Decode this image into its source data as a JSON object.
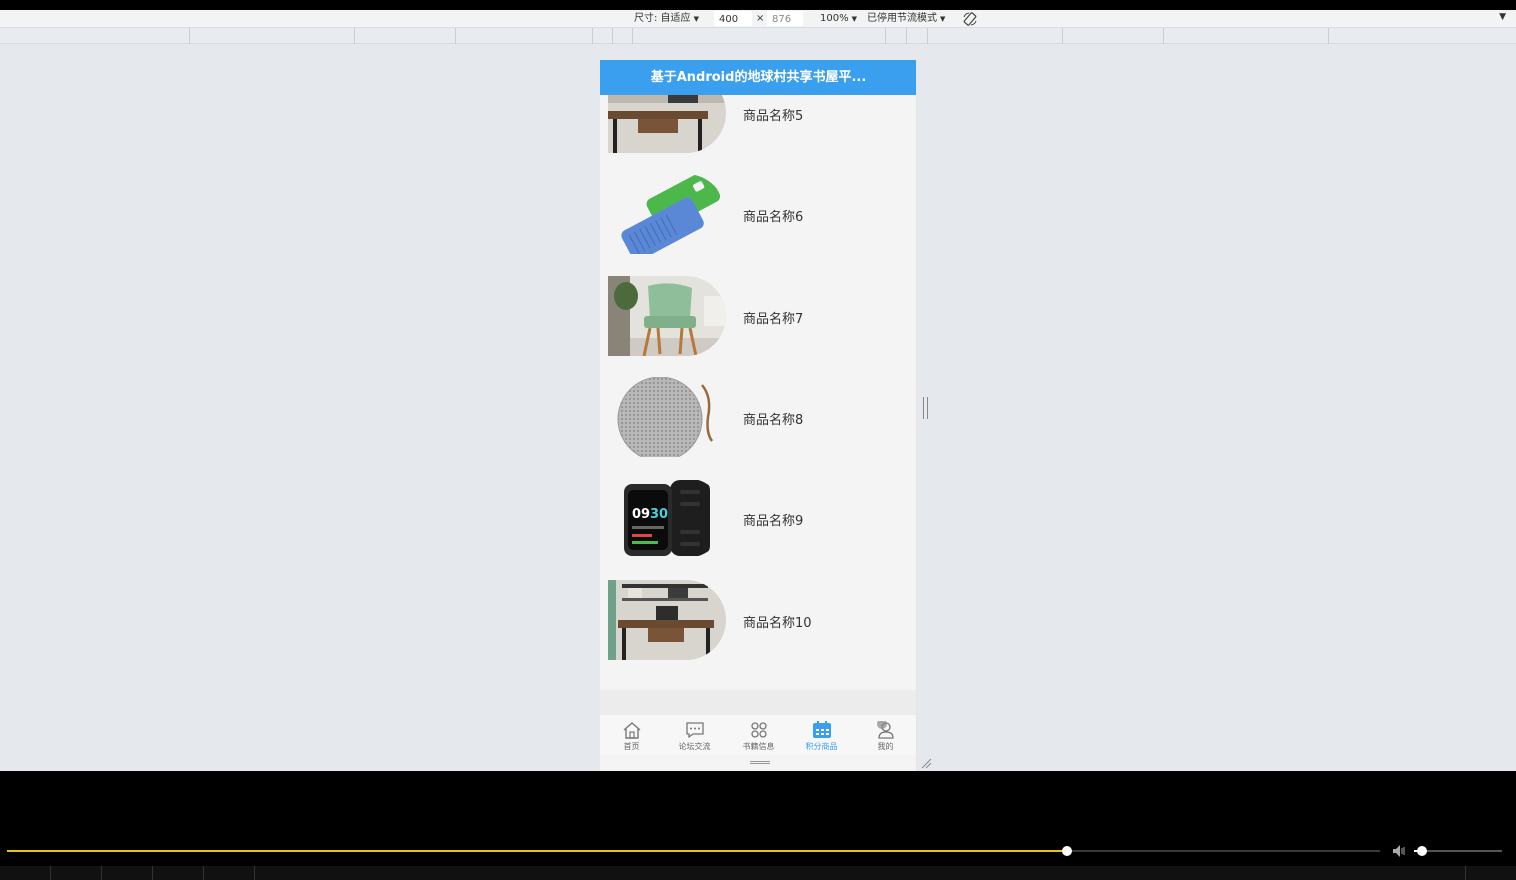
{
  "toolbar": {
    "size_label": "尺寸: 自适应",
    "width_value": "400",
    "times": "×",
    "height_value": "876",
    "zoom": "100%",
    "throttle": "已停用节流模式"
  },
  "app": {
    "title": "基于Android的地球村共享书屋平...",
    "accent_color": "#3a9fee",
    "items": [
      {
        "name": "商品名称5",
        "image": "desk"
      },
      {
        "name": "商品名称6",
        "image": "washboard"
      },
      {
        "name": "商品名称7",
        "image": "chair"
      },
      {
        "name": "商品名称8",
        "image": "speaker"
      },
      {
        "name": "商品名称9",
        "image": "smartwatch"
      },
      {
        "name": "商品名称10",
        "image": "desk"
      }
    ],
    "tabs": [
      {
        "label": "首页",
        "icon": "home-icon",
        "active": false
      },
      {
        "label": "论坛交流",
        "icon": "chat-icon",
        "active": false
      },
      {
        "label": "书籍信息",
        "icon": "grid-icon",
        "active": false
      },
      {
        "label": "积分商品",
        "icon": "calendar-icon",
        "active": true
      },
      {
        "label": "我的",
        "icon": "user-icon",
        "active": false
      }
    ]
  },
  "player": {
    "progress": 0.772,
    "volume": 0.09,
    "progress_color": "#e8c21a"
  }
}
